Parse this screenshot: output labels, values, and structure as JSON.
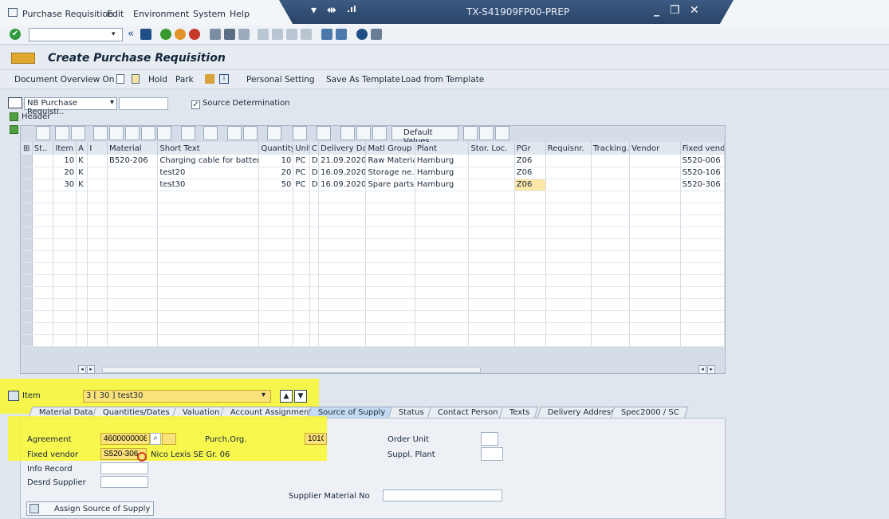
{
  "menu": {
    "items": [
      "Purchase Requisition",
      "Edit",
      "Environment",
      "System",
      "Help"
    ],
    "system_title": "TX-S41909FP00-PREP"
  },
  "toolbar": {
    "command_value": "",
    "nav_back": "«"
  },
  "title": "Create Purchase Requisition",
  "app_toolbar": {
    "document_overview": "Document Overview On",
    "hold": "Hold",
    "park": "Park",
    "personal_setting": "Personal Setting",
    "save_as_template": "Save As Template",
    "load_from_template": "Load from Template"
  },
  "header": {
    "doc_type": "NB Purchase Requisti..",
    "doc_number": "",
    "source_determination": "Source Determination",
    "source_determination_checked": true,
    "header_label": "Header"
  },
  "grid_toolbar": {
    "default_values": "Default Values"
  },
  "grid": {
    "columns": [
      "St..",
      "Item",
      "A",
      "I",
      "Material",
      "Short Text",
      "Quantity",
      "Unit",
      "C",
      "Delivery Date",
      "Matl Group",
      "Plant",
      "Stor. Loc.",
      "PGr",
      "Requisnr.",
      "Tracking..",
      "Vendor",
      "Fixed vendo"
    ],
    "rows": [
      [
        "",
        "10",
        "K",
        "",
        "B520-206",
        "Charging cable for battery",
        "10",
        "PC",
        "D",
        "21.09.2020",
        "Raw Materials",
        "Hamburg",
        "",
        "Z06",
        "",
        "",
        "",
        "S520-006"
      ],
      [
        "",
        "20",
        "K",
        "",
        "",
        "test20",
        "20",
        "PC",
        "D",
        "16.09.2020",
        "Storage ne..",
        "Hamburg",
        "",
        "Z06",
        "",
        "",
        "",
        "S520-106"
      ],
      [
        "",
        "30",
        "K",
        "",
        "",
        "test30",
        "50",
        "PC",
        "D",
        "16.09.2020",
        "Spare parts..",
        "Hamburg",
        "",
        "Z06",
        "",
        "",
        "",
        "S520-306"
      ]
    ],
    "empty_rows": 13
  },
  "item_selector": {
    "label": "Item",
    "value": "3 [ 30 ] test30"
  },
  "tabs": [
    "Material Data",
    "Quantities/Dates",
    "Valuation",
    "Account Assignment",
    "Source of Supply",
    "Status",
    "Contact Person",
    "Texts",
    "Delivery Address",
    "Spec2000 / SC"
  ],
  "active_tab": "Source of Supply",
  "source_of_supply": {
    "agreement_label": "Agreement",
    "agreement_value": "4600000008",
    "purch_org_label": "Purch.Org.",
    "purch_org_value": "101C",
    "fixed_vendor_label": "Fixed vendor",
    "fixed_vendor_value": "S520-306",
    "fixed_vendor_name": "Nico Lexis SE Gr. 06",
    "info_record_label": "Info Record",
    "info_record_value": "",
    "desired_supplier_label": "Desrd Supplier",
    "desired_supplier_value": "",
    "order_unit_label": "Order Unit",
    "order_unit_value": "",
    "suppl_plant_label": "Suppl. Plant",
    "suppl_plant_value": "",
    "supplier_material_label": "Supplier Material No",
    "supplier_material_value": "",
    "assign_button": "Assign Source of Supply"
  },
  "colors": {
    "highlight": "#faf828",
    "title_bar": "#2a4468",
    "active_tab": "#c4dcf2"
  }
}
